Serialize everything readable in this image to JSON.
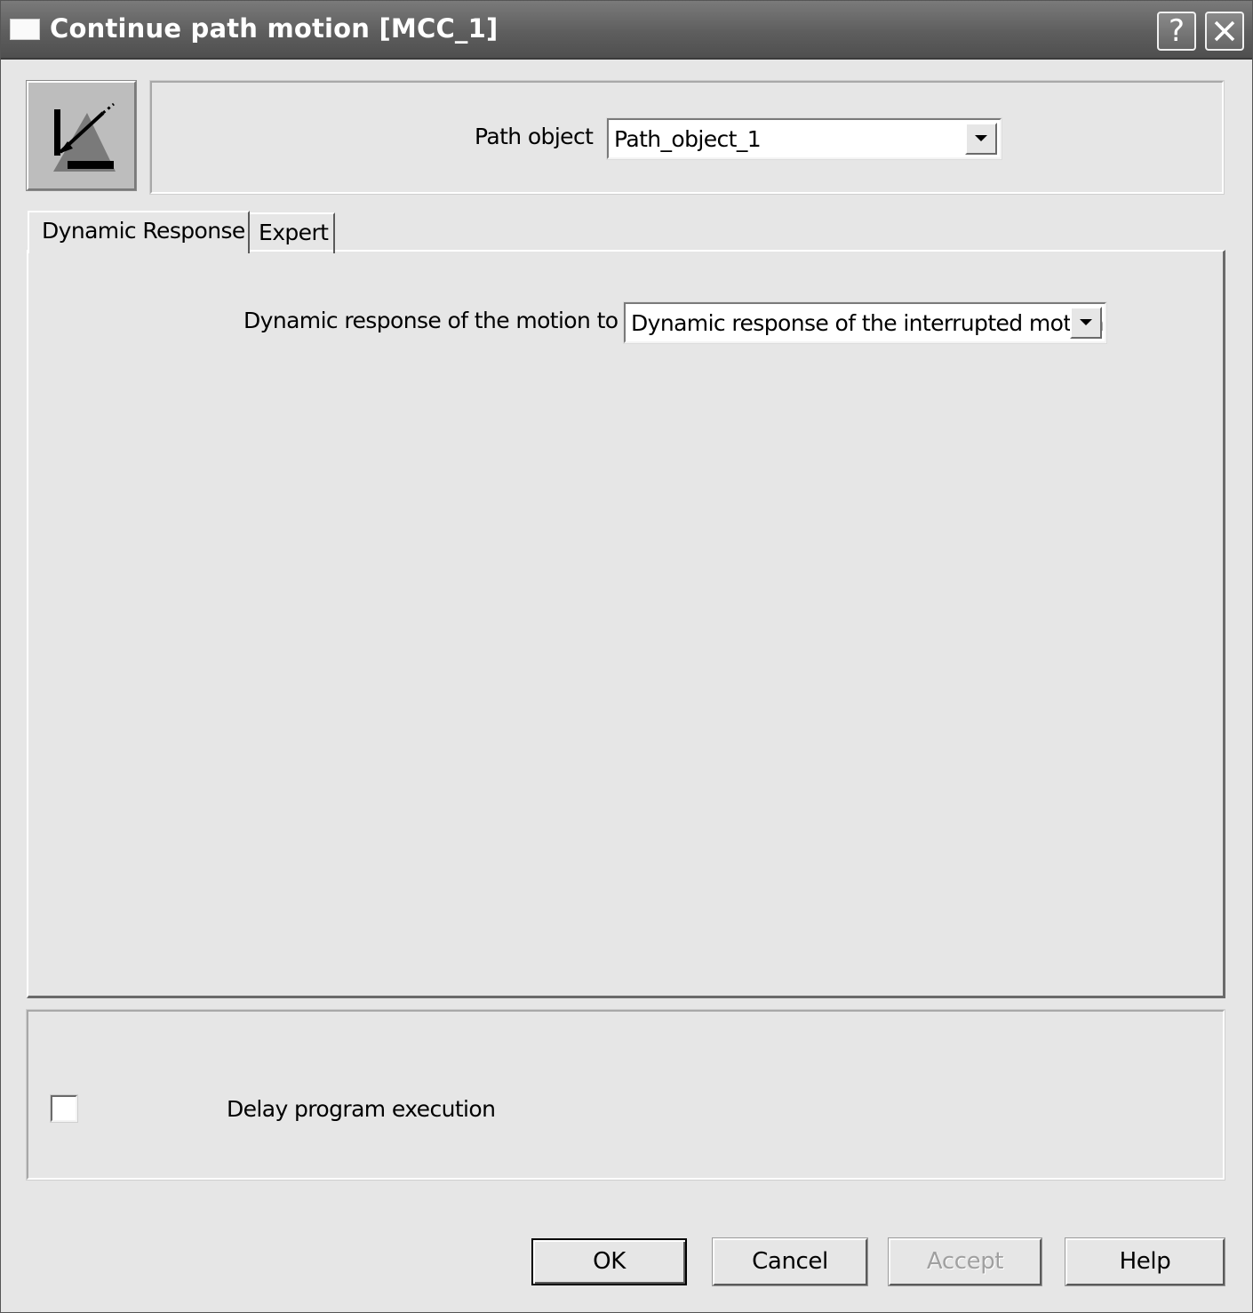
{
  "window": {
    "title": "Continue path motion [MCC_1]",
    "help_button": "?",
    "close_icon": "close-icon"
  },
  "header": {
    "icon": "path-motion-icon",
    "path_object_label": "Path object",
    "path_object_value": "Path_object_1"
  },
  "tabs": [
    {
      "label": "Dynamic Response",
      "active": true
    },
    {
      "label": "Expert",
      "active": false
    }
  ],
  "dynamic_response": {
    "label": "Dynamic response of the motion to be",
    "value": "Dynamic response of the interrupted motion"
  },
  "delay": {
    "label": "Delay program execution",
    "checked": false
  },
  "buttons": {
    "ok": "OK",
    "cancel": "Cancel",
    "accept": "Accept",
    "help": "Help"
  }
}
